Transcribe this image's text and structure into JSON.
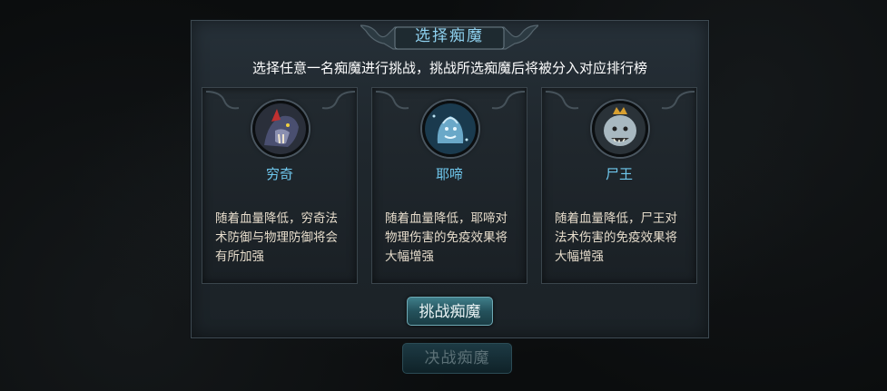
{
  "background_button": {
    "label": "决战痴魔"
  },
  "dialog": {
    "title": "选择痴魔",
    "subtitle": "选择任意一名痴魔进行挑战，挑战所选痴魔后将被分入对应排行榜",
    "cards": [
      {
        "name": "穷奇",
        "description": "随着血量降低，穷奇法术防御与物理防御将会有所加强",
        "icon": "qiongqi-portrait-icon"
      },
      {
        "name": "耶啼",
        "description": "随着血量降低，耶啼对物理伤害的免疫效果将大幅增强",
        "icon": "yeti-portrait-icon"
      },
      {
        "name": "尸王",
        "description": "随着血量降低，尸王对法术伤害的免疫效果将大幅增强",
        "icon": "zombie-king-portrait-icon"
      }
    ],
    "challenge_button": {
      "label": "挑战痴魔"
    }
  },
  "colors": {
    "title_text": "#8fd2f0",
    "card_name": "#6fc8ee",
    "description_text": "#e6dccb",
    "button_fill": "#2a5a64"
  }
}
